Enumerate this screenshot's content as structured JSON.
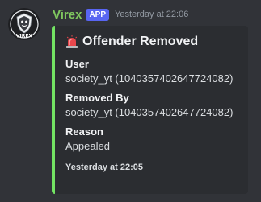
{
  "message": {
    "author": "Virex",
    "badge": "APP",
    "timestamp": "Yesterday at 22:06",
    "avatar_icon": "virex-shield-logo",
    "avatar_text": "VIREX",
    "username_color": "#80c85f"
  },
  "embed": {
    "accent_color": "#73e363",
    "title_icon": "police-siren-icon",
    "title": "Offender Removed",
    "fields": [
      {
        "name": "User",
        "value": "society_yt (1040357402647724082)"
      },
      {
        "name": "Removed By",
        "value": "society_yt (1040357402647724082)"
      },
      {
        "name": "Reason",
        "value": "Appealed"
      }
    ],
    "footer": "Yesterday at 22:05"
  }
}
